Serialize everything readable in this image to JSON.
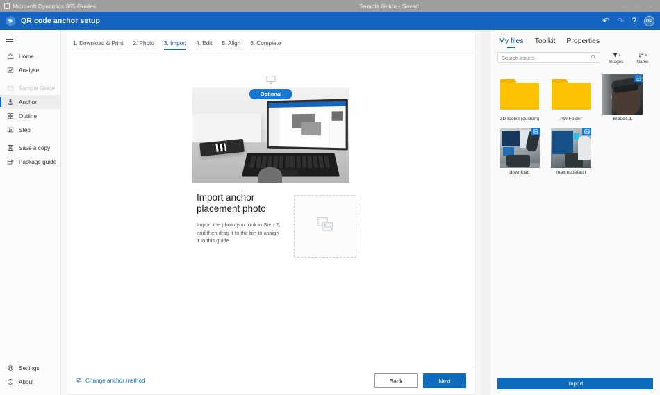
{
  "os_bar": {
    "app_name": "Microsoft Dynamics 365 Guides",
    "document_title": "Sample Guide - Saved",
    "minimize": "–",
    "maximize": "□",
    "close": "×"
  },
  "app_bar": {
    "title": "QR code anchor setup",
    "undo": "↶",
    "redo": "↷",
    "help": "?",
    "avatar_initials": "OP"
  },
  "sidebar": {
    "items": [
      {
        "label": "Home",
        "icon": "home-icon",
        "state": "normal"
      },
      {
        "label": "Analyse",
        "icon": "analyse-icon",
        "state": "normal"
      },
      {
        "label": "Sample Guide",
        "icon": "guide-icon",
        "state": "disabled"
      },
      {
        "label": "Anchor",
        "icon": "anchor-icon",
        "state": "selected"
      },
      {
        "label": "Outline",
        "icon": "outline-icon",
        "state": "normal"
      },
      {
        "label": "Step",
        "icon": "step-icon",
        "state": "normal"
      },
      {
        "label": "Save a copy",
        "icon": "save-copy-icon",
        "state": "normal"
      },
      {
        "label": "Package guide",
        "icon": "package-icon",
        "state": "normal"
      }
    ],
    "bottom_items": [
      {
        "label": "Settings",
        "icon": "gear-icon"
      },
      {
        "label": "About",
        "icon": "info-icon"
      }
    ]
  },
  "wizard": {
    "steps": [
      {
        "label": "1. Download & Print",
        "active": false
      },
      {
        "label": "2. Photo",
        "active": false
      },
      {
        "label": "3. Import",
        "active": true
      },
      {
        "label": "4. Edit",
        "active": false
      },
      {
        "label": "5. Align",
        "active": false
      },
      {
        "label": "6. Complete",
        "active": false
      }
    ],
    "optional_badge": "Optional",
    "heading": "Import anchor placement photo",
    "description": "Import the photo you took in Step 2, and then drag it to the bin to assign it to this guide.",
    "dropzone_icon": "photo-placeholder-icon"
  },
  "footer": {
    "change_anchor_label": "Change anchor method",
    "change_anchor_icon": "swap-icon",
    "back_label": "Back",
    "next_label": "Next"
  },
  "right_panel": {
    "tabs": [
      {
        "label": "My files",
        "active": true
      },
      {
        "label": "Toolkit",
        "active": false
      },
      {
        "label": "Properties",
        "active": false
      }
    ],
    "search_placeholder": "Search assets",
    "search_value": "",
    "search_icon": "search-icon",
    "filter": {
      "label": "Images",
      "icon": "filter-icon"
    },
    "sort": {
      "label": "Name",
      "icon": "sort-icon"
    },
    "files": [
      {
        "name": "3D toolkit (custom)",
        "type": "folder"
      },
      {
        "name": "AW Folder",
        "type": "folder"
      },
      {
        "name": "Blade1.1",
        "type": "image",
        "scene": "scene-blade"
      },
      {
        "name": "download",
        "type": "image",
        "scene": "scene-dl"
      },
      {
        "name": "maxresdefault",
        "type": "image",
        "scene": "scene-mx"
      }
    ],
    "import_label": "Import"
  },
  "colors": {
    "brand_blue": "#1565c0",
    "accent_blue": "#0f6cbd",
    "badge_blue": "#1778d4",
    "folder_yellow": "#fcc200",
    "titlebar_gray": "#9e9e9e"
  }
}
